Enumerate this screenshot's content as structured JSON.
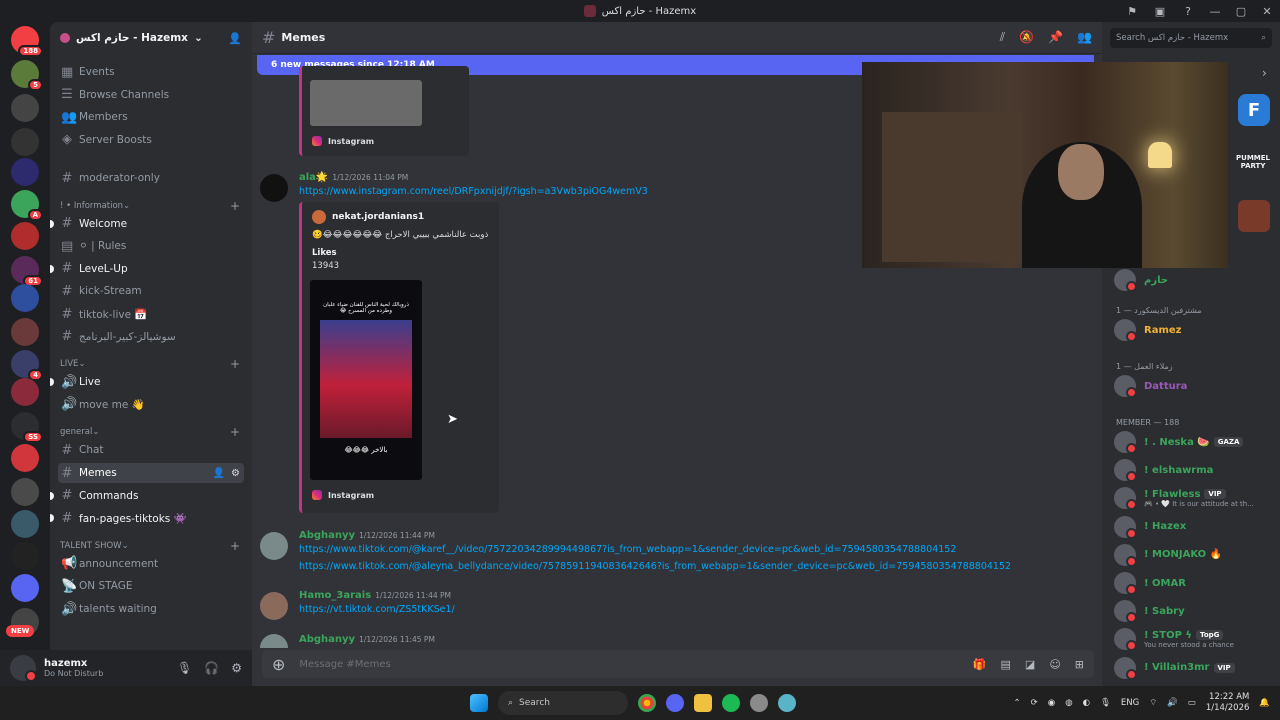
{
  "window": {
    "title": "حازم اكس - Hazemx",
    "controls": [
      "—",
      "▢",
      "✕"
    ]
  },
  "server_rail": {
    "items": [
      {
        "label": "188",
        "color": "#f23f43"
      },
      {
        "label": "5",
        "color": "#5b7b3a"
      },
      {
        "label": "",
        "color": "#444"
      },
      {
        "label": "",
        "color": "#333"
      },
      {
        "label": "",
        "color": "#2d2a6e"
      },
      {
        "label": "A",
        "color": "#3ba55c"
      },
      {
        "label": "",
        "color": "#b12d2d"
      },
      {
        "label": "61",
        "color": "#5a2b5a"
      },
      {
        "label": "",
        "color": "#2e4e9e"
      },
      {
        "label": "",
        "color": "#6a3a3a"
      },
      {
        "label": "4",
        "color": "#3a3f6a"
      },
      {
        "label": "",
        "color": "#8a2a3a"
      },
      {
        "label": "SS",
        "color": "#2b2d31"
      },
      {
        "label": "",
        "color": "#d0363c"
      },
      {
        "label": "",
        "color": "#4a4a4a"
      },
      {
        "label": "",
        "color": "#3a5a6a"
      },
      {
        "label": "",
        "color": "#222"
      },
      {
        "label": "",
        "color": "#5865f2"
      },
      {
        "label": "",
        "color": "#444"
      }
    ],
    "new_label": "NEW"
  },
  "guild": {
    "name": "حازم اكس - Hazemx"
  },
  "sidebar": {
    "top_items": [
      "Events",
      "Browse Channels",
      "Members",
      "Server Boosts"
    ],
    "channels": [
      {
        "label": "moderator-only",
        "type": "text",
        "bright": false
      },
      {
        "category": "! • Information"
      },
      {
        "label": "Welcome",
        "type": "text",
        "bright": true
      },
      {
        "label": "⚪ | Rules",
        "type": "rules",
        "bright": false
      },
      {
        "label": "LeveL-Up",
        "type": "text",
        "bright": true
      },
      {
        "label": "kick-Stream",
        "type": "text",
        "bright": false
      },
      {
        "label": "tiktok-live 📅",
        "type": "text",
        "bright": false
      },
      {
        "label": "سوشيالز-كبير-البرنامج",
        "type": "text",
        "bright": false
      },
      {
        "category": "LIVE"
      },
      {
        "label": "Live",
        "type": "voice",
        "bright": true
      },
      {
        "label": "move me 👋",
        "type": "voice",
        "bright": false
      },
      {
        "category": "general"
      },
      {
        "label": "Chat",
        "type": "text",
        "bright": false
      },
      {
        "label": "Memes",
        "type": "text",
        "bright": true,
        "active": true
      },
      {
        "label": "Commands",
        "type": "text",
        "bright": true
      },
      {
        "label": "fan-pages-tiktoks 👾",
        "type": "text",
        "bright": true
      },
      {
        "category": "TALENT SHOW"
      },
      {
        "label": "announcement",
        "type": "announce",
        "bright": false
      },
      {
        "label": "ON STAGE",
        "type": "stage",
        "bright": false
      },
      {
        "label": "talents waiting",
        "type": "voice",
        "bright": false
      }
    ]
  },
  "user": {
    "name": "hazemx",
    "status": "Do Not Disturb"
  },
  "channel": {
    "name": "Memes",
    "composer_placeholder": "Message #Memes"
  },
  "new_messages_bar": "6 new messages since 12:18 AM",
  "messages": {
    "m1": {
      "author": "ala🌟",
      "author_color": "#3ba55c",
      "time": "1/12/2026 11:04 PM",
      "link": "https://www.instagram.com/reel/DRFpxnijdjf/?igsh=a3Vwb3piOG4wemV3",
      "embed_author": "nekat.jordanians1",
      "embed_desc": "ذوبت عالناشمي ببيبي الاحراج 😂😂😂😂😂😂🥴",
      "likes_label": "Likes",
      "likes_value": "13943",
      "thumb_caption": "بالاخر 😂😂😂",
      "thumb_text": "ذروبالك لحية الناس للفنان ضياء علبان وطرده من المسرح 😂",
      "provider": "Instagram"
    },
    "prev_provider": "Instagram",
    "m2": {
      "author": "Abghanyy",
      "author_color": "#3ba55c",
      "time": "1/12/2026 11:44 PM",
      "links": [
        "https://www.tiktok.com/@karef__/video/7572203428999449867?is_from_webapp=1&sender_device=pc&web_id=7594580354788804152",
        "https://www.tiktok.com/@aleyna_bellydance/video/7578591194083642646?is_from_webapp=1&sender_device=pc&web_id=7594580354788804152"
      ]
    },
    "m3": {
      "author": "Hamo_3arais",
      "author_color": "#3ba55c",
      "time": "1/12/2026 11:44 PM",
      "link": "https://vt.tiktok.com/ZS5tKKSe1/"
    },
    "m4": {
      "author": "Abghanyy",
      "author_color": "#3ba55c",
      "time": "1/12/2026 11:45 PM"
    }
  },
  "members": {
    "search_placeholder": "Search حازم اكس - Hazemx",
    "top_member": {
      "name": "حازم",
      "color": "#3ba55c"
    },
    "groups": [
      {
        "header": "مشترفين الديسكورد — 1",
        "members": [
          {
            "name": "Ramez",
            "color": "#f0b232"
          }
        ]
      },
      {
        "header": "زملاء العمل — 1",
        "members": [
          {
            "name": "Dattura",
            "color": "#9b59b6"
          }
        ]
      },
      {
        "header": "MEMBER — 188",
        "members": [
          {
            "name": "! . Neska 🍉",
            "color": "#3ba55c",
            "tag": "GAZA"
          },
          {
            "name": "! elshawrma",
            "color": "#3ba55c"
          },
          {
            "name": "! Flawless",
            "color": "#3ba55c",
            "tag": "VIP",
            "sub": "🎮 • 🤍 It is our attitude at th..."
          },
          {
            "name": "! Hazex",
            "color": "#3ba55c"
          },
          {
            "name": "! MONJAKO 🔥",
            "color": "#3ba55c"
          },
          {
            "name": "! OMAR",
            "color": "#3ba55c"
          },
          {
            "name": "! Sabry",
            "color": "#3ba55c"
          },
          {
            "name": "! STOP ϟ",
            "color": "#3ba55c",
            "tag": "TopG",
            "sub": "You never stood a chance"
          },
          {
            "name": "! Villain3mr",
            "color": "#3ba55c",
            "tag": "VIP"
          }
        ]
      }
    ]
  },
  "activity": {
    "party_label": "PUMMEL PARTY"
  },
  "taskbar": {
    "search_label": "Search",
    "lang": "ENG",
    "time": "12:22 AM",
    "date": "1/14/2026"
  }
}
